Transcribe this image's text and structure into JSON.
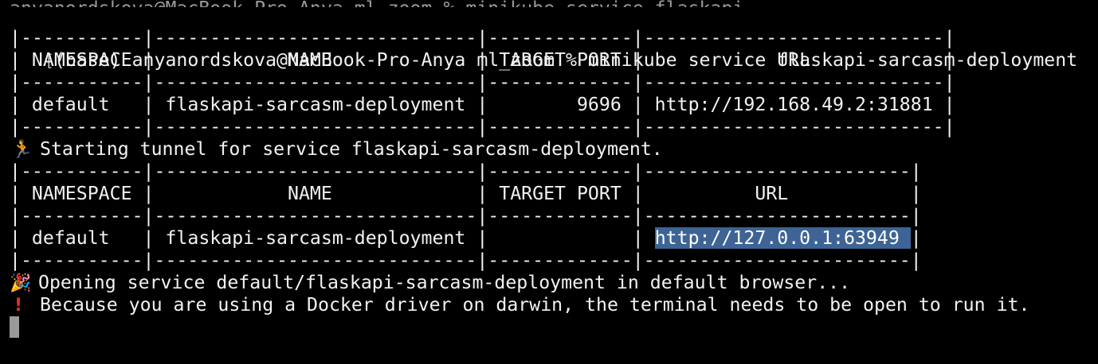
{
  "prompt": {
    "clipped_previous_line": "anyanordskova@MacBook-Pro-Anya ml_zoom % minikube service flaskapi",
    "text": "(base) anyanordskova@MacBook-Pro-Anya ml_zoom % minikube service flaskapi-sarcasm-deployment"
  },
  "table1": {
    "border": "|-----------|-----------------------------|-------------|---------------------------|",
    "header": "| NAMESPACE |            NAME             | TARGET PORT |            URL            |",
    "row": "| default   | flaskapi-sarcasm-deployment |        9696 | http://192.168.49.2:31881 |"
  },
  "tunnel_message": {
    "icon": "runner-icon",
    "text": "Starting tunnel for service flaskapi-sarcasm-deployment."
  },
  "table2": {
    "border": "|-----------|-----------------------------|-------------|------------------------|",
    "header": "| NAMESPACE |            NAME             | TARGET PORT |          URL           |",
    "row_prefix": "| default   | flaskapi-sarcasm-deployment |             | ",
    "row_url": "http://127.0.0.1:63949 ",
    "row_suffix": "|"
  },
  "opening_message": {
    "icon": "party-popper-icon",
    "text": "Opening service default/flaskapi-sarcasm-deployment in default browser..."
  },
  "warning_message": {
    "icon": "exclamation-icon",
    "text": "Because you are using a Docker driver on darwin, the terminal needs to be open to run it."
  },
  "colors": {
    "background": "#000000",
    "foreground": "#f2f2f2",
    "selection": "#3d6494",
    "warning": "#e0301e"
  }
}
